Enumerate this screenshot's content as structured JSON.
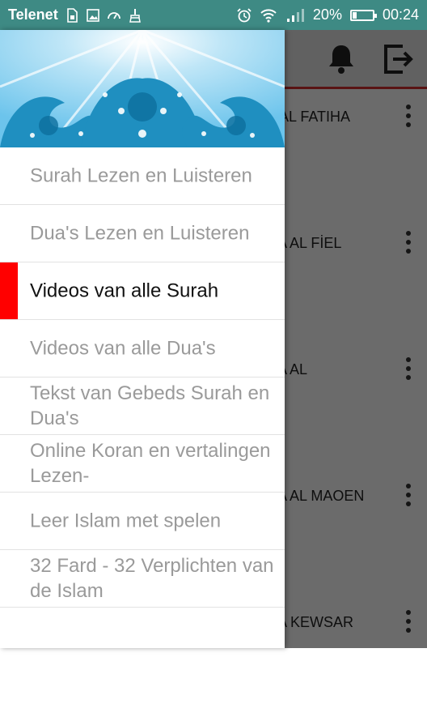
{
  "status_bar": {
    "carrier": "Telenet",
    "battery_percent": "20%",
    "battery_level": 0.2,
    "time": "00:24",
    "background_color": "#3e8a84",
    "icons": [
      "sim-icon",
      "image-icon",
      "gauge-icon",
      "broom-icon",
      "alarm-icon",
      "wifi-icon",
      "signal-icon",
      "battery-icon"
    ]
  },
  "toolbar": {
    "icons": [
      "bell-icon",
      "exit-icon"
    ],
    "accent_color": "#d32f2f"
  },
  "list": {
    "items": [
      {
        "title": "A AL FATIHA"
      },
      {
        "title": "RA AL FİEL"
      },
      {
        "title": "RA AL\nS"
      },
      {
        "title": "RA AL MAOEN"
      },
      {
        "title": "RA KEWSAR"
      }
    ]
  },
  "drawer": {
    "header_image": "ornamental-waves",
    "active_color": "#ff0000",
    "items": [
      {
        "label": "Surah Lezen en Luisteren",
        "active": false
      },
      {
        "label": "Dua's Lezen en Luisteren",
        "active": false
      },
      {
        "label": "Videos van alle Surah",
        "active": true
      },
      {
        "label": "Videos van alle Dua's",
        "active": false
      },
      {
        "label": "Tekst van Gebeds Surah en Dua's",
        "active": false
      },
      {
        "label": "Online Koran en vertalingen Lezen-",
        "active": false
      },
      {
        "label": "Leer Islam met spelen",
        "active": false
      },
      {
        "label": "32 Fard - 32 Verplichten van de Islam",
        "active": false
      }
    ]
  }
}
